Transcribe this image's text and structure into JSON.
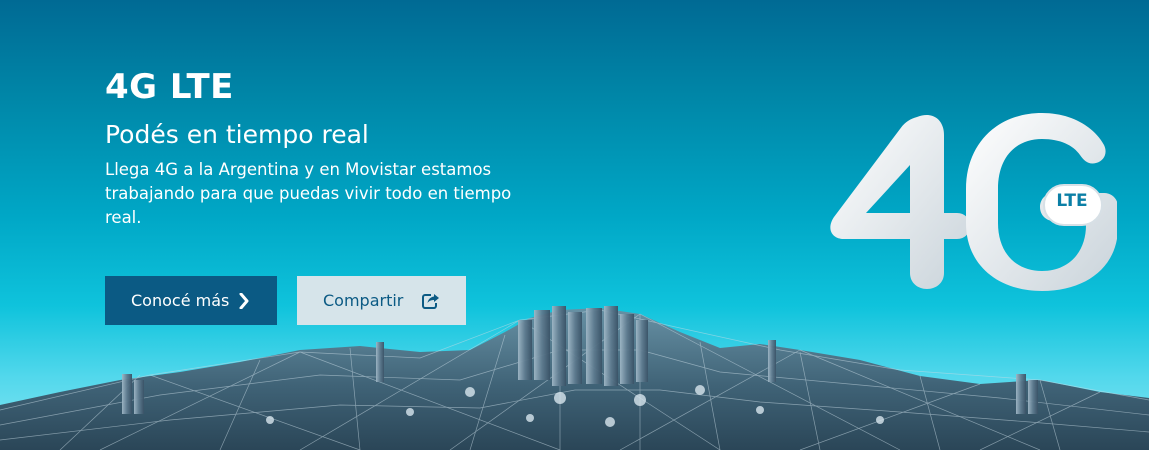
{
  "banner": {
    "title": "4G LTE",
    "subtitle": "Podés en tiempo real",
    "description": "Llega 4G a la Argentina y en Movistar estamos trabajando para que puedas vivir todo en tiempo real."
  },
  "buttons": {
    "primary_label": "Conocé más",
    "primary_icon": "chevron-right-icon",
    "secondary_label": "Compartir",
    "secondary_icon": "share-icon"
  },
  "logo": {
    "main_text": "4G",
    "badge_text": "LTE"
  },
  "colors": {
    "primary_button": "#0b5a84",
    "secondary_button": "#d6e4ea",
    "gradient_top": "#006a94",
    "gradient_bottom": "#8ae6f2"
  }
}
